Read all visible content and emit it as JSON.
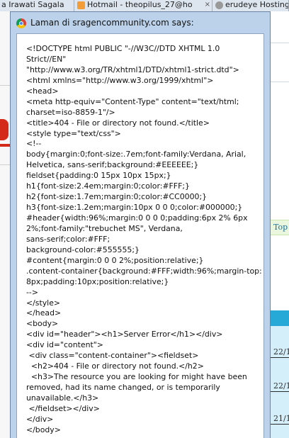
{
  "browser": {
    "tabs": [
      {
        "label": "a Irawati Sagala"
      },
      {
        "label": "Hotmail - theopilus_27@ho",
        "icon": "hotmail-icon"
      },
      {
        "label": "erudeye Hosting",
        "icon": "globe-icon"
      }
    ],
    "close_glyph": "×",
    "side_text": "Top",
    "dates": [
      "22/1",
      "22/1",
      "21/1"
    ]
  },
  "dialog": {
    "title": "Laman di sragencommunity.com says:",
    "icon": "chrome-icon",
    "lines": [
      "<!DOCTYPE html PUBLIC \"-//W3C//DTD XHTML 1.0",
      "Strict//EN\"",
      "\"http://www.w3.org/TR/xhtml1/DTD/xhtml1-strict.dtd\">",
      "<html xmlns=\"http://www.w3.org/1999/xhtml\">",
      "<head>",
      "<meta http-equiv=\"Content-Type\" content=\"text/html;",
      "charset=iso-8859-1\"/>",
      "<title>404 - File or directory not found.</title>",
      "<style type=\"text/css\">",
      "<!--",
      "body{margin:0;font-size:.7em;font-family:Verdana, Arial,",
      "Helvetica, sans-serif;background:#EEEEEE;}",
      "fieldset{padding:0 15px 10px 15px;}",
      "h1{font-size:2.4em;margin:0;color:#FFF;}",
      "h2{font-size:1.7em;margin:0;color:#CC0000;}",
      "h3{font-size:1.2em;margin:10px 0 0 0;color:#000000;}",
      "#header{width:96%;margin:0 0 0 0;padding:6px 2% 6px",
      "2%;font-family:\"trebuchet MS\", Verdana,",
      "sans-serif;color:#FFF;",
      "background-color:#555555;}",
      "#content{margin:0 0 0 2%;position:relative;}",
      ".content-container{background:#FFF;width:96%;margin-top:",
      "8px;padding:10px;position:relative;}",
      "-->",
      "</style>",
      "</head>",
      "<body>",
      "<div id=\"header\"><h1>Server Error</h1></div>",
      "<div id=\"content\">",
      " <div class=\"content-container\"><fieldset>",
      "  <h2>404 - File or directory not found.</h2>",
      "  <h3>The resource you are looking for might have been",
      "removed, had its name changed, or is temporarily",
      "unavailable.</h3>",
      " </fieldset></div>",
      "</div>",
      "</body>"
    ]
  }
}
